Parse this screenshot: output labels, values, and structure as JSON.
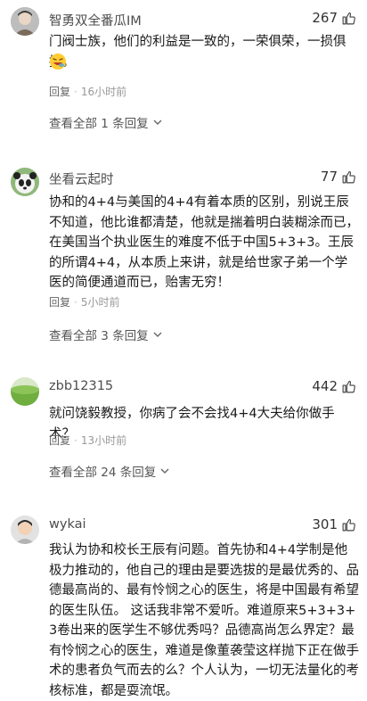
{
  "comments": [
    {
      "username": "智勇双全番瓜IM",
      "likes": "267",
      "content": "门阀士族，他们的利益是一致的，一荣俱荣，一损俱损。",
      "reply_label": "回复",
      "time": "16小时前",
      "view_all": "查看全部 1 条回复",
      "avatar_icon": "avatar-icon",
      "emoji_icon": "laughing-emoji-icon"
    },
    {
      "username": "坐看云起时",
      "likes": "77",
      "content": "协和的4+4与美国的4+4有着本质的区别，别说王辰不知道，他比谁都清楚，他就是揣着明白装糊涂而已，在美国当个执业医生的难度不低于中国5+3+3。王辰的所谓4+4，从本质上来讲，就是给世家子弟一个学医的简便通道而已，贻害无穷！",
      "reply_label": "回复",
      "time": "5小时前",
      "view_all": "查看全部 3 条回复",
      "avatar_icon": "panda-avatar-icon"
    },
    {
      "username": "zbb12315",
      "likes": "442",
      "content": "就问饶毅教授，你病了会不会找4+4大夫给你做手术？",
      "reply_label": "回复",
      "time": "13小时前",
      "view_all": "查看全部 24 条回复",
      "avatar_icon": "green-landscape-avatar-icon"
    },
    {
      "username": "wykai",
      "likes": "301",
      "content": "我认为协和校长王辰有问题。首先协和4+4学制是他极力推动的，他自己的理由是要选拔的是最优秀的、品德最高尚的、最有怜悯之心的医生，将是中国最有希望的医生队伍。 这话我非常不爱听。难道原来5+3+3+3卷出来的医学生不够优秀吗？品德高尚怎么界定？最有怜悯之心的医生，难道是像董袭莹这样抛下正在做手术的患者负气而去的么？个人认为，一切无法量化的考核标准，都是耍流氓。",
      "avatar_icon": "child-avatar-icon"
    }
  ],
  "colors": {
    "like_icon": "#444444",
    "meta_text": "#999999"
  }
}
